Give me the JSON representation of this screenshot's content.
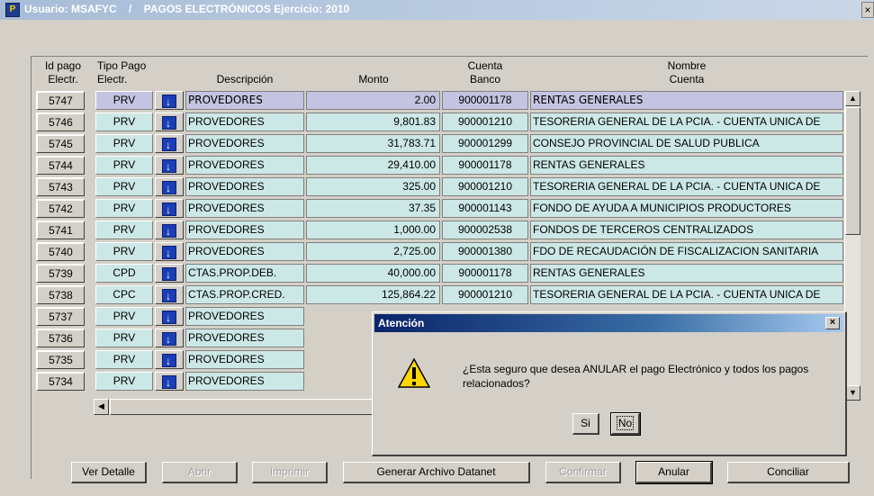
{
  "window": {
    "title_user": "Usuario: MSAFYC",
    "title_sep": "/",
    "title_module": "PAGOS ELECTRÓNICOS  Ejercicio: 2010",
    "app_icon_text": "P"
  },
  "headers": {
    "id1": "Id pago",
    "id2": "Electr.",
    "tipo1": "Tipo Pago",
    "tipo2": "Electr.",
    "desc": "Descripción",
    "monto": "Monto",
    "cta1": "Cuenta",
    "cta2": "Banco",
    "nom1": "Nombre",
    "nom2": "Cuenta"
  },
  "rows": [
    {
      "id": "5747",
      "tipo": "PRV",
      "desc": "PROVEDORES",
      "monto": "2.00",
      "cta": "900001178",
      "nombre": "RENTAS GENERALES"
    },
    {
      "id": "5746",
      "tipo": "PRV",
      "desc": "PROVEDORES",
      "monto": "9,801.83",
      "cta": "900001210",
      "nombre": "TESORERIA GENERAL DE LA PCIA. - CUENTA UNICA DE"
    },
    {
      "id": "5745",
      "tipo": "PRV",
      "desc": "PROVEDORES",
      "monto": "31,783.71",
      "cta": "900001299",
      "nombre": "CONSEJO PROVINCIAL DE SALUD PUBLICA"
    },
    {
      "id": "5744",
      "tipo": "PRV",
      "desc": "PROVEDORES",
      "monto": "29,410.00",
      "cta": "900001178",
      "nombre": "RENTAS GENERALES"
    },
    {
      "id": "5743",
      "tipo": "PRV",
      "desc": "PROVEDORES",
      "monto": "325.00",
      "cta": "900001210",
      "nombre": "TESORERIA GENERAL DE LA PCIA. - CUENTA UNICA DE"
    },
    {
      "id": "5742",
      "tipo": "PRV",
      "desc": "PROVEDORES",
      "monto": "37.35",
      "cta": "900001143",
      "nombre": "FONDO DE AYUDA A MUNICIPIOS PRODUCTORES"
    },
    {
      "id": "5741",
      "tipo": "PRV",
      "desc": "PROVEDORES",
      "monto": "1,000.00",
      "cta": "900002538",
      "nombre": "FONDOS DE TERCEROS CENTRALIZADOS"
    },
    {
      "id": "5740",
      "tipo": "PRV",
      "desc": "PROVEDORES",
      "monto": "2,725.00",
      "cta": "900001380",
      "nombre": "FDO DE RECAUDACIÓN DE FISCALIZACION SANITARIA"
    },
    {
      "id": "5739",
      "tipo": "CPD",
      "desc": "CTAS.PROP.DEB.",
      "monto": "40,000.00",
      "cta": "900001178",
      "nombre": "RENTAS GENERALES"
    },
    {
      "id": "5738",
      "tipo": "CPC",
      "desc": "CTAS.PROP.CRED.",
      "monto": "125,864.22",
      "cta": "900001210",
      "nombre": "TESORERIA GENERAL DE LA PCIA. - CUENTA UNICA DE"
    },
    {
      "id": "5737",
      "tipo": "PRV",
      "desc": "PROVEDORES",
      "monto": "",
      "cta": "",
      "nombre": ""
    },
    {
      "id": "5736",
      "tipo": "PRV",
      "desc": "PROVEDORES",
      "monto": "",
      "cta": "",
      "nombre": ""
    },
    {
      "id": "5735",
      "tipo": "PRV",
      "desc": "PROVEDORES",
      "monto": "",
      "cta": "",
      "nombre": ""
    },
    {
      "id": "5734",
      "tipo": "PRV",
      "desc": "PROVEDORES",
      "monto": "",
      "cta": "",
      "nombre": ""
    }
  ],
  "buttons": {
    "ver_detalle": "Ver Detalle",
    "abrir": "Abrir",
    "imprimir": "Imprimir",
    "generar": "Generar Archivo Datanet",
    "confirmar": "Confirmar",
    "anular": "Anular",
    "conciliar": "Conciliar"
  },
  "dialog": {
    "title": "Atención",
    "message": "¿Esta seguro que desea ANULAR el pago Electrónico y todos los pagos relacionados?",
    "si": "Si",
    "no": "No",
    "close": "×"
  },
  "icons": {
    "app": "app-icon",
    "close": "close-icon",
    "lov": "arrow-down-icon",
    "warning": "warning-icon"
  },
  "colors": {
    "cell_bg": "#cce8e6",
    "selected_bg": "#c4c4e2",
    "lov_button": "#1c3eb5",
    "dialog_title": "#0a246a"
  }
}
